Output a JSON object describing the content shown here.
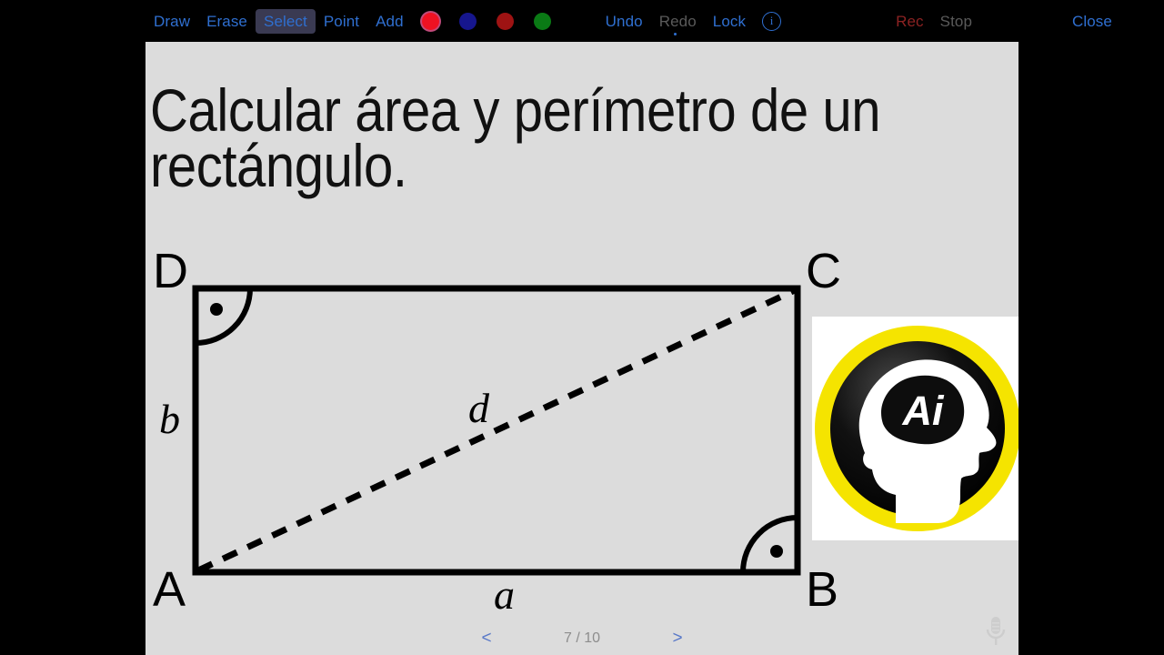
{
  "toolbar": {
    "draw": "Draw",
    "erase": "Erase",
    "select": "Select",
    "point": "Point",
    "add": "Add",
    "undo": "Undo",
    "redo": "Redo",
    "lock": "Lock",
    "info": "i",
    "rec": "Rec",
    "stop": "Stop",
    "close": "Close",
    "colors": [
      {
        "name": "color-swatch-red",
        "hex": "#ee1122",
        "selected": true
      },
      {
        "name": "color-swatch-blue",
        "hex": "#16168e",
        "selected": false
      },
      {
        "name": "color-swatch-dark-red",
        "hex": "#9e1313",
        "selected": false
      },
      {
        "name": "color-swatch-green",
        "hex": "#0a7a15",
        "selected": false
      }
    ]
  },
  "slide": {
    "title": "Calcular área y perímetro de un rectángulo.",
    "background_hex": "#dcdcdc",
    "vertices": {
      "top_left": "D",
      "top_right": "C",
      "bottom_left": "A",
      "bottom_right": "B"
    },
    "sides": {
      "base": "a",
      "height": "b",
      "diagonal": "d"
    },
    "logo": {
      "text": "Ai",
      "ring_hex": "#f5e400",
      "disc_hex": "#111111"
    }
  },
  "pagination": {
    "prev": "<",
    "next": ">",
    "indicator": "7 / 10",
    "current": 7,
    "total": 10
  }
}
